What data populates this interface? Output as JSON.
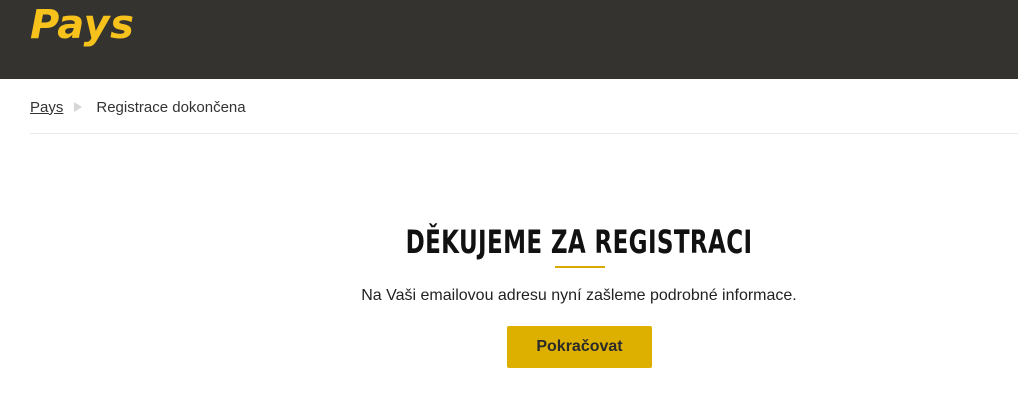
{
  "header": {
    "logo_text": "Pays",
    "logo_color": "#f6c21b",
    "background_color": "#353330"
  },
  "breadcrumb": {
    "home_label": "Pays",
    "separator_icon": "triangle-right-icon",
    "current_label": "Registrace dokončena"
  },
  "main": {
    "title": "DĚKUJEME ZA REGISTRACI",
    "subtitle": "Na Vaši emailovou adresu nyní zašleme podrobné informace.",
    "continue_label": "Pokračovat",
    "accent_color": "#ddb000"
  }
}
